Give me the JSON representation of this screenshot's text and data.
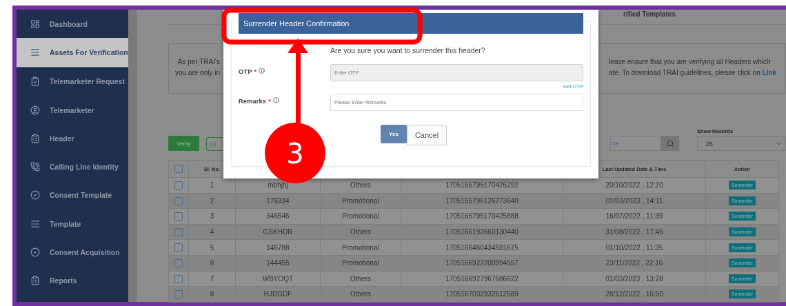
{
  "sidebar": {
    "items": [
      {
        "label": "Dashboard",
        "selected": false
      },
      {
        "label": "Assets For Verification",
        "selected": true
      },
      {
        "label": "Telemarketer Request",
        "selected": false
      },
      {
        "label": "Telemarketer",
        "selected": false
      },
      {
        "label": "Header",
        "selected": false
      },
      {
        "label": "Calling Line Identity",
        "selected": false
      },
      {
        "label": "Consent Template",
        "selected": false
      },
      {
        "label": "Template",
        "selected": false
      },
      {
        "label": "Consent Acquisition",
        "selected": false
      },
      {
        "label": "Reports",
        "selected": false
      }
    ]
  },
  "tabs": [
    {
      "label": "rified Templates",
      "selected": false
    }
  ],
  "info": {
    "left_lines": [
      "As per TRAI's",
      "you are only in"
    ],
    "right_lines": [
      "lease ensure that you are verifying all Headers which",
      "ate. To download TRAI guidelines, please click on **Link**"
    ]
  },
  "toolbar": {
    "verify_button": "Verify",
    "hint": "Cli",
    "search": {
      "placeholder": "ne"
    },
    "show_records": {
      "label": "Show Records",
      "value": "25"
    }
  },
  "table": {
    "header_checked": false,
    "columns": [
      "Sl. No.",
      "",
      "",
      "",
      "Last Updated Date & Time",
      "Action"
    ],
    "rows": [
      {
        "checked": false,
        "cells": [
          "1",
          "mbhjhj",
          "Others",
          "1705165795170426292",
          "20/10/2022 , 12:20"
        ],
        "action": "Surrender"
      },
      {
        "checked": false,
        "cells": [
          "2",
          "178334",
          "Promotional",
          "1705165796126273640",
          "01/03/2023 , 14:11"
        ],
        "action": "Surrender"
      },
      {
        "checked": false,
        "cells": [
          "3",
          "346546",
          "Promotional",
          "1705165795170425888",
          "16/07/2022 , 11:39"
        ],
        "action": "Surrender"
      },
      {
        "checked": false,
        "cells": [
          "4",
          "GSKHDR",
          "Others",
          "1705166192660130440",
          "31/08/2022 , 17:46"
        ],
        "action": "Surrender"
      },
      {
        "checked": false,
        "cells": [
          "5",
          "146788",
          "Promotional",
          "1705166460434581675",
          "01/10/2022 , 11:35"
        ],
        "action": "Surrender"
      },
      {
        "checked": false,
        "cells": [
          "6",
          "144455",
          "Promotional",
          "1705166922200994557",
          "23/11/2022 , 22:16"
        ],
        "action": "Surrender"
      },
      {
        "checked": false,
        "cells": [
          "7",
          "WBYOQT",
          "Others",
          "1705166927967686622",
          "01/03/2023 , 13:28"
        ],
        "action": "Surrender"
      },
      {
        "checked": false,
        "cells": [
          "8",
          "HJDGDF",
          "Others",
          "1705167032932512589",
          "28/12/2022 , 15:50"
        ],
        "action": "Surrender"
      }
    ]
  },
  "modal": {
    "title": "Surrender Header Confirmation",
    "question": "Are you sure you want to surrender this header?",
    "fields": [
      {
        "label": "OTP",
        "required_mark": "*",
        "placeholder": "Enter OTP",
        "disabled": true,
        "link": "Get OTP"
      },
      {
        "label": "Remarks",
        "required_mark": "*",
        "placeholder": "Please Enter Remarks",
        "disabled": false
      }
    ],
    "buttons": [
      {
        "label": "Yes",
        "kind": "primary"
      },
      {
        "label": "Cancel",
        "kind": "secondary"
      }
    ]
  },
  "annotation": {
    "number": "3"
  }
}
